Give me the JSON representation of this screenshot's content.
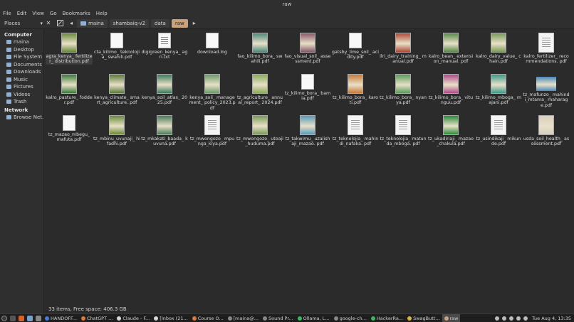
{
  "window": {
    "title": "raw"
  },
  "menu": [
    "File",
    "Edit",
    "View",
    "Go",
    "Bookmarks",
    "Help"
  ],
  "toolbar": {
    "places_label": "Places",
    "breadcrumbs": [
      "maina",
      "shambaiq-v2",
      "data",
      "raw"
    ]
  },
  "sidebar": {
    "computer_header": "Computer",
    "computer_items": [
      "maina",
      "Desktop",
      "File System",
      "Documents",
      "Downloads",
      "Music",
      "Pictures",
      "Videos",
      "Trash"
    ],
    "network_header": "Network",
    "network_items": [
      "Browse Net..."
    ]
  },
  "files": [
    {
      "name": "agra_kenya_ fertilizer_ distribution.pdf",
      "kind": "photo",
      "color": "#6a8a3a"
    },
    {
      "name": "cta_kilimo_ teknolojia_ swahili.pdf",
      "kind": "blank",
      "color": "#f4f4f4"
    },
    {
      "name": "digigreen_kenya_ agri.txt",
      "kind": "txt",
      "color": "#f4f4f4"
    },
    {
      "name": "download.log",
      "kind": "blank",
      "color": "#f4f4f4"
    },
    {
      "name": "fao_kilimo_bora_ swahili.pdf",
      "kind": "photo",
      "color": "#4f8a7a"
    },
    {
      "name": "fao_visual_soil_ assessment.pdf",
      "kind": "photo",
      "color": "#8a5a6a"
    },
    {
      "name": "gatsby_lime_soil_ acidity.pdf",
      "kind": "blank",
      "color": "#f4f4f4"
    },
    {
      "name": "ilri_dairy_training_ manual.pdf",
      "kind": "photo",
      "color": "#b04a3a"
    },
    {
      "name": "kalro_bean_ extension_manual. pdf",
      "kind": "photo",
      "color": "#5a8a4a"
    },
    {
      "name": "kalro_dairy_value_ chain.pdf",
      "kind": "photo",
      "color": "#7a9a5a"
    },
    {
      "name": "kalro_fertilizer_ recommendations. pdf",
      "kind": "doc",
      "color": "#c84a3a"
    },
    {
      "name": "kalro_pasture_ fodder.pdf",
      "kind": "photo",
      "color": "#3a7a3a"
    },
    {
      "name": "kenya_climate_ smart_agriculture. pdf",
      "kind": "photo",
      "color": "#5a7a3a"
    },
    {
      "name": "kenya_soil_atlas_ 2025.pdf",
      "kind": "photo",
      "color": "#3a7a5a"
    },
    {
      "name": "kenya_soil_ management_ policy_2023.pdf",
      "kind": "photo",
      "color": "#6a9a6a"
    },
    {
      "name": "tz_agriculture_ annual_report_ 2024.pdf",
      "kind": "photo",
      "color": "#8aaa5a"
    },
    {
      "name": "tz_kilimo_bora_ bamia.pdf",
      "kind": "blank",
      "color": "#f4f4f4"
    },
    {
      "name": "tz_kilimo_bora_ karoti.pdf",
      "kind": "photo",
      "color": "#c87a3a"
    },
    {
      "name": "tz_kilimo_bora_ nyanya.pdf",
      "kind": "photo",
      "color": "#5a9a5a"
    },
    {
      "name": "tz_kilimo_bora_ vitunguu.pdf",
      "kind": "photo",
      "color": "#b04a8a"
    },
    {
      "name": "tz_kilimo_mboga_ majani.pdf",
      "kind": "photo",
      "color": "#3a9a8a"
    },
    {
      "name": "tz_mafunzo_ mahindi_mtama_ maharage.pdf",
      "kind": "wide",
      "color": "#4a8aba"
    },
    {
      "name": "tz_mazao_mbegu_ mafuta.pdf",
      "kind": "blank",
      "color": "#f4f4f4"
    },
    {
      "name": "tz_mbinu_uvunaji_ hifadhi.pdf",
      "kind": "photo",
      "color": "#6a8a3a"
    },
    {
      "name": "tz_mkakati_baada_ kuvuna.pdf",
      "kind": "photo",
      "color": "#4a7a5a"
    },
    {
      "name": "tz_mwongozo_ mpunga_kiya.pdf",
      "kind": "doc",
      "color": "#f4f4f4"
    },
    {
      "name": "tz_mwongozo_ utoaji_huduma.pdf",
      "kind": "photo",
      "color": "#7a9a5a"
    },
    {
      "name": "tz_takwimu_ uzalishaji_mazao. pdf",
      "kind": "photo",
      "color": "#5a9aba"
    },
    {
      "name": "tz_teknolojia_ mahindi_nafaka. pdf",
      "kind": "doc",
      "color": "#f4f4f4"
    },
    {
      "name": "tz_teknolojia_ matunda_mboga. pdf",
      "kind": "doc",
      "color": "#f4f4f4"
    },
    {
      "name": "tz_ukadiriaji_ mazao_chakula.pdf",
      "kind": "photo",
      "color": "#2a8a3a"
    },
    {
      "name": "tz_usindikaji_ mikunde.pdf",
      "kind": "doc",
      "color": "#f4f4f4"
    },
    {
      "name": "usda_soil_health_ assessment.pdf",
      "kind": "photo",
      "color": "#d8d0c0"
    }
  ],
  "status": {
    "text": "33 items, Free space: 406.3 GB"
  },
  "taskbar": {
    "tasks": [
      {
        "label": "HANDOFF...",
        "color": "#4a7ad8"
      },
      {
        "label": "ChatGPT ...",
        "color": "#d87a3a"
      },
      {
        "label": "Claude - F...",
        "color": "#d8d8d8"
      },
      {
        "label": "[Inbox (21...",
        "color": "#d8d8d8"
      },
      {
        "label": "Course O...",
        "color": "#d87a3a"
      },
      {
        "label": "[maina@...",
        "color": "#888888"
      },
      {
        "label": "Sound Pr...",
        "color": "#888888"
      },
      {
        "label": "Ollama, L...",
        "color": "#3ab85a"
      },
      {
        "label": "google-ch...",
        "color": "#888888"
      },
      {
        "label": "HackerRa...",
        "color": "#3ab85a"
      },
      {
        "label": "SwagButt...",
        "color": "#d8b83a"
      },
      {
        "label": "raw",
        "color": "#c9a17a"
      }
    ],
    "clock": "Tue Aug  4, 13:35"
  }
}
